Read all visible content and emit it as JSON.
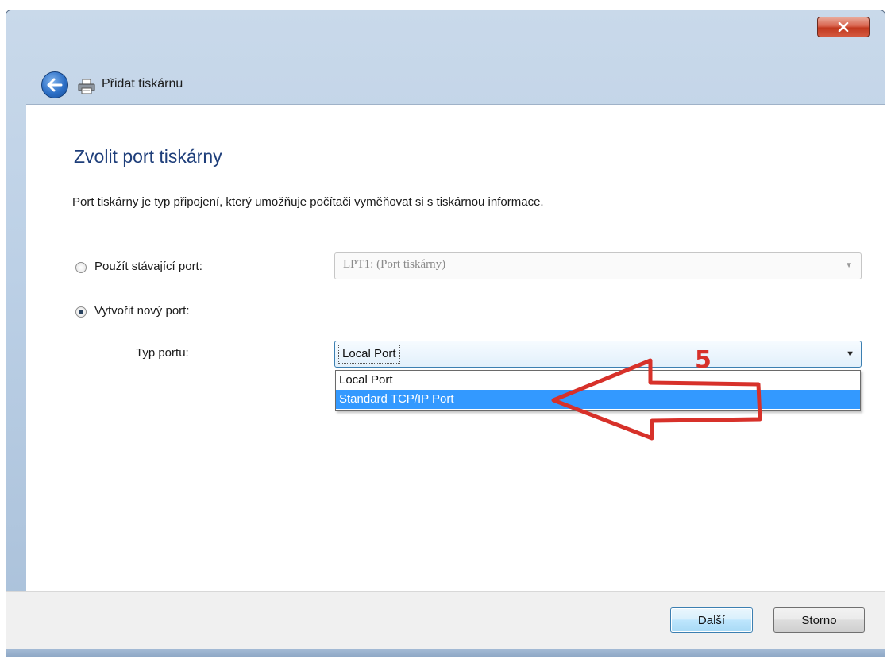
{
  "window": {
    "title": "Přidat tiskárnu",
    "close_label": "x"
  },
  "page": {
    "heading": "Zvolit port tiskárny",
    "description": "Port tiskárny je typ připojení, který umožňuje počítači vyměňovat si s tiskárnou informace."
  },
  "options": {
    "existing_port_label": "Použít stávající port:",
    "existing_port_value": "LPT1: (Port tiskárny)",
    "existing_port_checked": false,
    "new_port_label": "Vytvořit nový port:",
    "new_port_checked": true,
    "port_type_label": "Typ portu:",
    "port_type_value": "Local Port",
    "port_type_options": [
      "Local Port",
      "Standard TCP/IP Port"
    ],
    "highlighted_option": "Standard TCP/IP Port"
  },
  "annotation": {
    "number": "5",
    "color": "#d7312a"
  },
  "buttons": {
    "next": "Další",
    "cancel": "Storno"
  },
  "colors": {
    "heading": "#1e3e7a",
    "selection": "#3399ff",
    "close": "#c1391f"
  }
}
